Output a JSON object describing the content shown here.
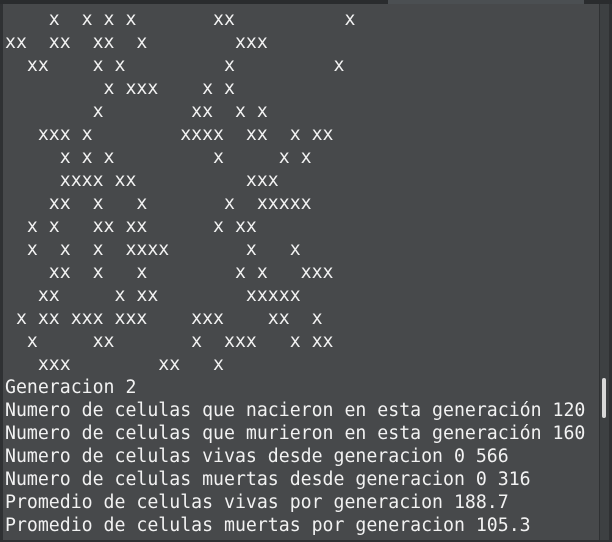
{
  "terminal": {
    "grid_lines": [
      "    x  x x x       xx          x",
      "xx  xx  xx  x        xxx",
      "  xx    x x         x         x",
      "         x xxx    x x",
      "        x        xx  x x",
      "   xxx x        xxxx  xx  x xx",
      "     x x x         x     x x",
      "     xxxx xx          xxx",
      "    xx  x   x       x  xxxxx",
      "  x x   xx xx      x xx",
      "  x  x  x  xxxx       x   x",
      "    xx  x   x        x x   xxx",
      "   xx     x xx        xxxxx",
      " x xx xxx xxx    xxx    xx  x",
      "  x     xx       x  xxx   x xx",
      "   xxx        xx   x"
    ],
    "output_lines": [
      "Generacion 2",
      "Numero de celulas que nacieron en esta generación 120",
      "Numero de celulas que murieron en esta generación 160",
      "Numero de celulas vivas desde generacion 0 566",
      "Numero de celulas muertas desde generacion 0 316",
      "Promedio de celulas vivas por generacion 188.7",
      "Promedio de celulas muertas por generacion 105.3"
    ]
  },
  "colors": {
    "terminal_background": "#47494b",
    "text": "#f2f2f2"
  }
}
